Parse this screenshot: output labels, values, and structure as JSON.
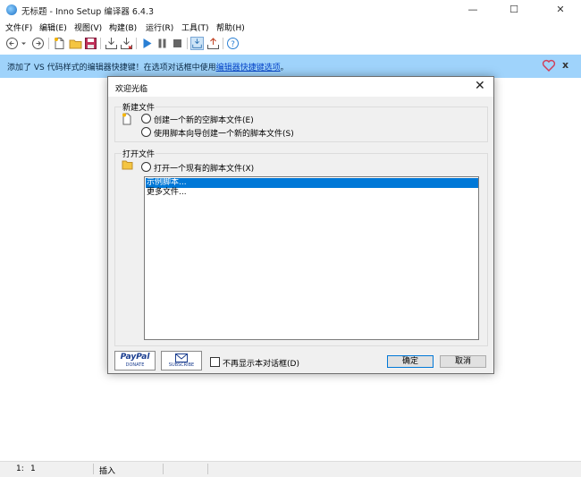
{
  "window": {
    "title": "无标题 - Inno Setup 编译器 6.4.3",
    "controls": {
      "minimize": "—",
      "maximize": "☐",
      "close": "✕"
    }
  },
  "menu": [
    "文件(F)",
    "编辑(E)",
    "视图(V)",
    "构建(B)",
    "运行(R)",
    "工具(T)",
    "帮助(H)"
  ],
  "toolbar": {
    "icons": [
      "back-icon",
      "dropdown-icon",
      "forward-icon",
      "new-file-icon",
      "open-folder-icon",
      "save-icon",
      "compile-icon",
      "stop-compile-icon",
      "run-icon",
      "pause-icon",
      "terminate-icon",
      "debug-icon",
      "upload-icon",
      "help-icon"
    ]
  },
  "banner": {
    "text": "添加了 VS 代码样式的编辑器快捷键！在选项对话框中使用",
    "link": "编辑器快捷键选项",
    "suffix": "。",
    "close": "x"
  },
  "status": {
    "line": "1:",
    "col": "1",
    "mode": "插入"
  },
  "dialog": {
    "title": "欢迎光临",
    "close": "✕",
    "new_group": {
      "label": "新建文件",
      "options": [
        "创建一个新的空脚本文件(E)",
        "使用脚本向导创建一个新的脚本文件(S)"
      ]
    },
    "open_group": {
      "label": "打开文件",
      "option": "打开一个现有的脚本文件(X)",
      "items": [
        "示例脚本...",
        "更多文件..."
      ],
      "selected_index": 0
    },
    "paypal": {
      "brand": "PayPal",
      "sub": "DONATE"
    },
    "subscribe": {
      "icon": "envelope-icon",
      "sub": "SUBSCRIBE"
    },
    "checkbox_label": "不再显示本对话框(D)",
    "ok_label": "确定",
    "cancel_label": "取消"
  }
}
